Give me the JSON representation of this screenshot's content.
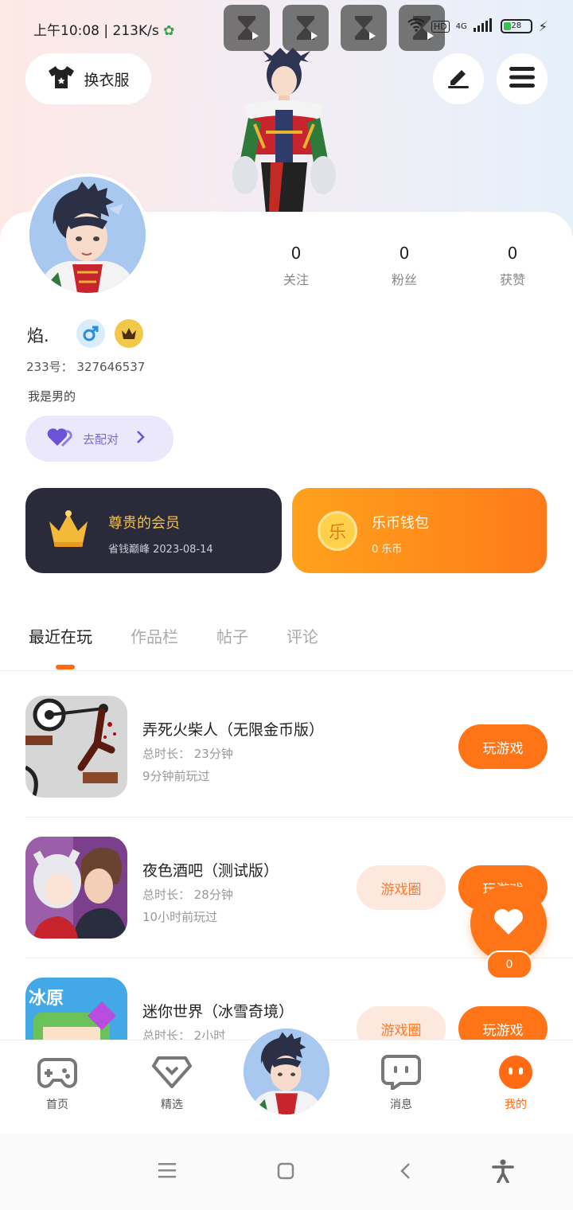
{
  "status_bar": {
    "time": "上午10:08",
    "speed": "213K/s",
    "network": "4G",
    "hd": "HD",
    "battery": "28"
  },
  "header": {
    "outfit_label": "换衣服"
  },
  "profile": {
    "stats": [
      {
        "value": "0",
        "label": "关注"
      },
      {
        "value": "0",
        "label": "粉丝"
      },
      {
        "value": "0",
        "label": "获赞"
      }
    ],
    "username": "焰.",
    "uid": "233号： 327646537",
    "bio": "我是男的",
    "match_label": "去配对"
  },
  "cards": {
    "vip_title": "尊贵的会员",
    "vip_sub": "省钱巅峰 2023-08-14",
    "coin_symbol": "乐",
    "coin_title": "乐币钱包",
    "coin_sub": "0 乐币"
  },
  "tabs": [
    {
      "label": "最近在玩"
    },
    {
      "label": "作品栏"
    },
    {
      "label": "帖子"
    },
    {
      "label": "评论"
    }
  ],
  "games": [
    {
      "title": "弄死火柴人（无限金币版）",
      "total_time": "总时长： 23分钟",
      "last_played": "9分钟前玩过",
      "play_label": "玩游戏"
    },
    {
      "title": "夜色酒吧（测试版）",
      "total_time": "总时长： 28分钟",
      "last_played": "10小时前玩过",
      "circle_label": "游戏圈",
      "play_label": "玩游戏"
    },
    {
      "title": "迷你世界（冰雪奇境）",
      "total_time": "总时长： 2小时",
      "circle_label": "游戏圈",
      "play_label": "玩游戏",
      "icon_text": "冰原"
    }
  ],
  "like_count": "0",
  "bottom_nav": [
    {
      "label": "首页",
      "icon": "gamepad-icon"
    },
    {
      "label": "精选",
      "icon": "heart-diamond-icon"
    },
    {
      "label": "消息",
      "icon": "chat-icon"
    },
    {
      "label": "我的",
      "icon": "face-icon"
    }
  ],
  "colors": {
    "accent": "#ff7417",
    "vip_bg": "#2b2a3b",
    "match_bg": "#ebe8fb"
  }
}
